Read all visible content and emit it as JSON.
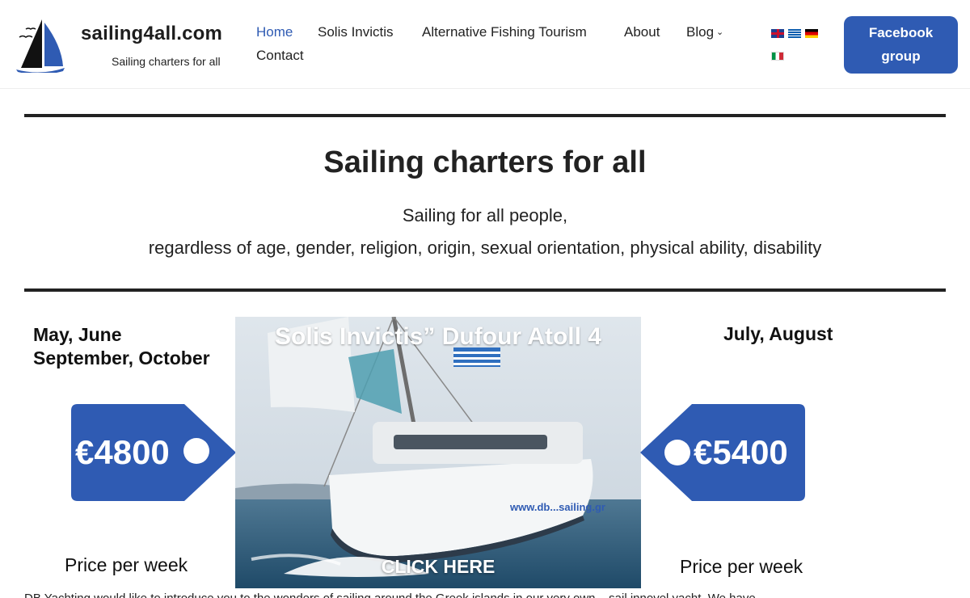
{
  "header": {
    "site_title": "sailing4all.com",
    "site_tagline": "Sailing charters for all",
    "nav": {
      "home": "Home",
      "solis": "Solis Invictis",
      "fishing": "Alternative Fishing Tourism",
      "about": "About",
      "blog": "Blog",
      "contact": "Contact"
    },
    "facebook_line1": "Facebook",
    "facebook_line2": "group"
  },
  "hero": {
    "title": "Sailing charters for all",
    "line1": "Sailing for all people,",
    "line2": "regardless of age, gender, religion, origin, sexual orientation, physical ability, disability"
  },
  "promo": {
    "left_season_1": "May, June",
    "left_season_2": "September, October",
    "right_season": "July, August",
    "left_price": "€4800",
    "right_price": "€5400",
    "price_caption": "Price per week",
    "boat_title": "Solis Invictis” Dufour Atoll 4",
    "cta": "CLICK HERE"
  },
  "intro_text": "DB Yachting would like to introduce you to the wonders of sailing around the Greek islands in our very own... sail innovel yacht. We have",
  "colors": {
    "accent": "#2f5bb3",
    "text": "#222222"
  }
}
